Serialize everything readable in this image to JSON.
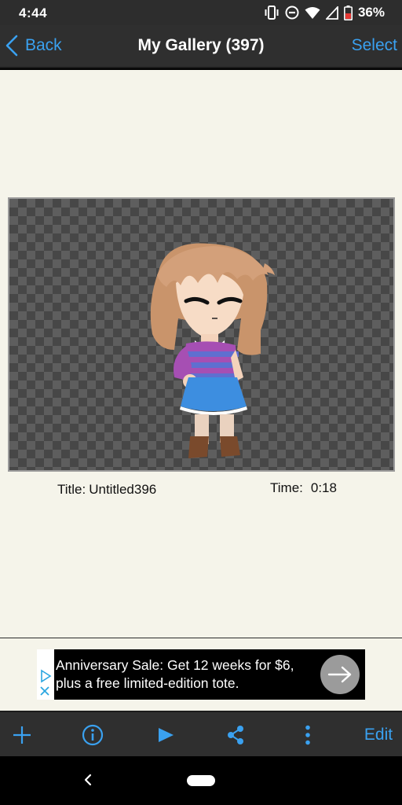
{
  "status_bar": {
    "time": "4:44",
    "battery_percent": "36%",
    "icons": [
      "vibrate-icon",
      "do-not-disturb-icon",
      "wifi-icon",
      "signal-icon",
      "battery-icon"
    ]
  },
  "nav": {
    "back_label": "Back",
    "title": "My Gallery (397)",
    "select_label": "Select"
  },
  "item": {
    "title_label": "Title:",
    "title_value": "Untitled396",
    "time_label": "Time:",
    "time_value": "0:18"
  },
  "ad": {
    "text": "Anniversary Sale: Get 12 weeks for $6, plus a free limited-edition tote."
  },
  "toolbar": {
    "icons": [
      "add-icon",
      "info-icon",
      "play-icon",
      "share-icon",
      "more-icon"
    ],
    "edit_label": "Edit"
  },
  "colors": {
    "accent": "#3aa1f0",
    "bar": "#2f2f2f",
    "content_bg": "#f5f4ea"
  }
}
